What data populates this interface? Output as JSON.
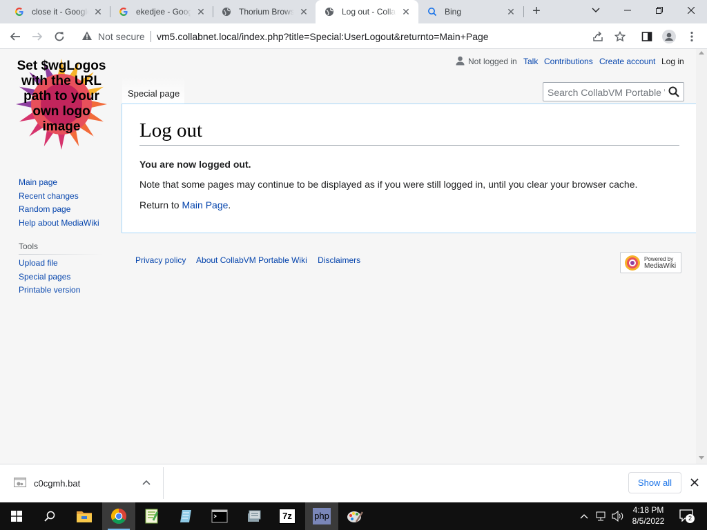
{
  "browser": {
    "tabs": [
      {
        "title": "close it - Google",
        "icon": "google-icon",
        "active": false
      },
      {
        "title": "ekedjee - Google",
        "icon": "google-icon",
        "active": false
      },
      {
        "title": "Thorium Browser",
        "icon": "globe-icon",
        "active": false
      },
      {
        "title": "Log out - CollabVM Portable Wiki",
        "icon": "globe-icon",
        "active": true
      },
      {
        "title": "Bing",
        "icon": "search-icon",
        "active": false
      }
    ],
    "omnibox": {
      "security_label": "Not secure",
      "url": "vm5.collabnet.local/index.php?title=Special:UserLogout&returnto=Main+Page"
    }
  },
  "wiki": {
    "logo_text": "Set $wgLogos with the URL path to your own logo image",
    "personal": {
      "status": "Not logged in",
      "talk": "Talk",
      "contributions": "Contributions",
      "create_account": "Create account",
      "login": "Log in"
    },
    "namespace_tab": "Special page",
    "search_placeholder": "Search CollabVM Portable Wiki",
    "heading": "Log out",
    "message_bold": "You are now logged out.",
    "message_note": "Note that some pages may continue to be displayed as if you were still logged in, until you clear your browser cache.",
    "return_prefix": "Return to ",
    "return_link": "Main Page",
    "return_suffix": ".",
    "navigation": [
      "Main page",
      "Recent changes",
      "Random page",
      "Help about MediaWiki"
    ],
    "tools_heading": "Tools",
    "tools": [
      "Upload file",
      "Special pages",
      "Printable version"
    ],
    "footer_links": [
      "Privacy policy",
      "About CollabVM Portable Wiki",
      "Disclaimers"
    ],
    "powered_by": {
      "line1": "Powered by",
      "line2": "MediaWiki"
    }
  },
  "downloads": {
    "file": "c0cgmh.bat",
    "show_all": "Show all"
  },
  "taskbar": {
    "apps": [
      "file-explorer-icon",
      "chrome-icon",
      "notepad-plus-plus-icon",
      "notepad-icon",
      "terminal-icon",
      "registry-icon",
      "7zip-icon",
      "php-icon",
      "paint-icon"
    ],
    "seven_zip_label": "7z",
    "php_label": "php",
    "time": "4:18 PM",
    "date": "8/5/2022",
    "notification_count": "2"
  },
  "colors": {
    "link": "#0645ad",
    "content_border": "#a7d7f9",
    "taskbar": "#101010",
    "show_all": "#1a73e8"
  }
}
